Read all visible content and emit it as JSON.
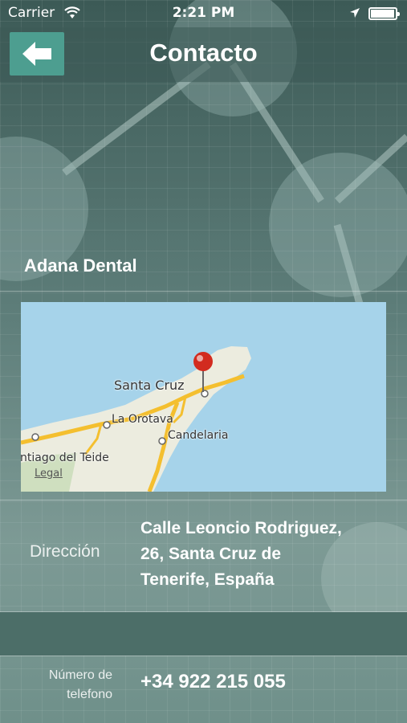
{
  "status_bar": {
    "carrier": "Carrier",
    "time": "2:21 PM",
    "battery_level": 0.95
  },
  "nav": {
    "title": "Contacto",
    "back_icon": "arrow-left-icon"
  },
  "company": {
    "name": "Adana Dental"
  },
  "map": {
    "labels": {
      "santa_cruz": "Santa Cruz",
      "la_orotava": "La Orotava",
      "candelaria": "Candelaria",
      "santiago": "ntiago del Teide",
      "legal": "Legal"
    },
    "pin_color": "#d22b1f",
    "sea_color": "#a6d3ea",
    "road_color": "#f4bf2f"
  },
  "contact": {
    "address_label": "Dirección",
    "address_lines": [
      "Calle Leoncio Rodriguez,",
      "26, Santa Cruz de",
      "Tenerife, España"
    ],
    "phone_label_lines": [
      "Número de",
      "telefono"
    ],
    "phone_value": "+34 922 215 055"
  },
  "colors": {
    "accent": "#4d9e90",
    "band": "#4c6e68"
  }
}
